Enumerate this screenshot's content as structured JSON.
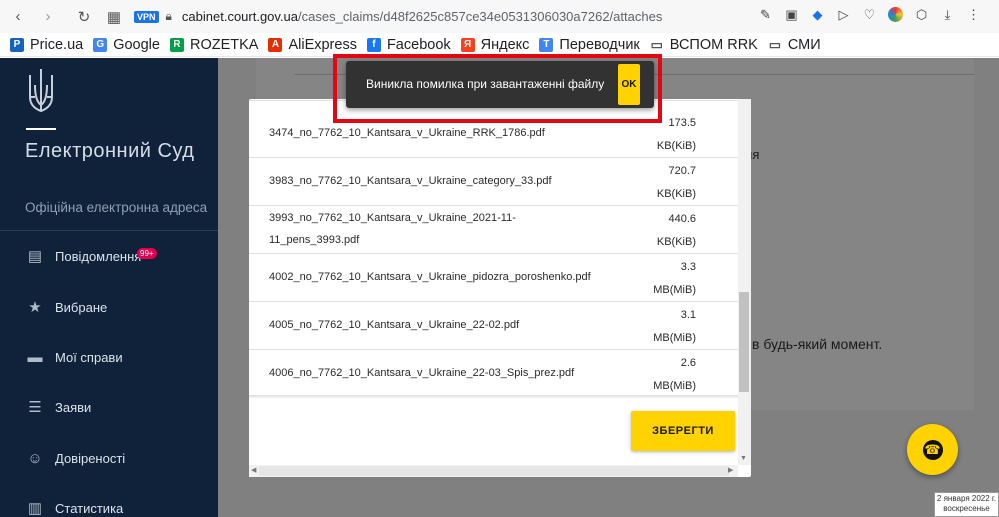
{
  "browser": {
    "vpn_label": "VPN",
    "url_host": "cabinet.court.gov.ua",
    "url_path": "/cases_claims/d48f2625c857ce34e0531306030a7262/attaches"
  },
  "bookmarks": [
    {
      "label": "Price.ua",
      "icon": "price-icon",
      "color": "#1565c0"
    },
    {
      "label": "Google",
      "icon": "google-icon",
      "color": "#4285f4"
    },
    {
      "label": "ROZETKA",
      "icon": "rozetka-icon",
      "color": "#00a046"
    },
    {
      "label": "AliExpress",
      "icon": "aliexpress-icon",
      "color": "#e62e04"
    },
    {
      "label": "Facebook",
      "icon": "facebook-icon",
      "color": "#1877f2"
    },
    {
      "label": "Яндекс",
      "icon": "yandex-icon",
      "color": "#fc3f1d"
    },
    {
      "label": "Переводчик",
      "icon": "translate-icon",
      "color": "#4285f4"
    },
    {
      "label": "ВСПОМ RRK",
      "icon": "folder-icon",
      "color": "#555555"
    },
    {
      "label": "СМИ",
      "icon": "folder-icon",
      "color": "#555555"
    }
  ],
  "sidebar": {
    "title": "Електронний Суд",
    "subtitle": "Офіційна електронна адреса",
    "items": [
      {
        "label": "Повідомлення",
        "icon": "message-icon"
      },
      {
        "label": "Вибране",
        "icon": "star-icon"
      },
      {
        "label": "Мої справи",
        "icon": "folder-icon"
      },
      {
        "label": "Заяви",
        "icon": "list-icon"
      },
      {
        "label": "Довіреності",
        "icon": "people-icon"
      },
      {
        "label": "Статистика",
        "icon": "chart-icon"
      }
    ],
    "notifications_badge": "99+"
  },
  "background": {
    "text_fragment_1": "ння",
    "text_fragment_2": "в будь-який момент."
  },
  "modal": {
    "partial_top_text": "(...)",
    "files": [
      {
        "name": "3474_no_7762_10_Kantsara_v_Ukraine_RRK_1786.pdf",
        "size": "173.5",
        "unit": "KB(KiB)"
      },
      {
        "name": "3983_no_7762_10_Kantsara_v_Ukraine_category_33.pdf",
        "size": "720.7",
        "unit": "KB(KiB)"
      },
      {
        "name": "3993_no_7762_10_Kantsara_v_Ukraine_2021-11-11_pens_3993.pdf",
        "name_line1": "3993_no_7762_10_Kantsara_v_Ukraine_2021-11-",
        "name_line2": "11_pens_3993.pdf",
        "size": "440.6",
        "unit": "KB(KiB)"
      },
      {
        "name": "4002_no_7762_10_Kantsara_v_Ukraine_pidozra_poroshenko.pdf",
        "size": "3.3",
        "unit": "MB(MiB)"
      },
      {
        "name": "4005_no_7762_10_Kantsara_v_Ukraine_22-02.pdf",
        "size": "3.1",
        "unit": "MB(MiB)"
      },
      {
        "name": "4006_no_7762_10_Kantsara_v_Ukraine_22-03_Spis_prez.pdf",
        "size": "2.6",
        "unit": "MB(MiB)"
      }
    ],
    "save_label": "ЗБЕРЕГТИ"
  },
  "toast": {
    "message": "Виникла помилка при завантаженні файлу",
    "ok_label": "OK"
  },
  "datestamp": {
    "line1": "2 января 2022 г.",
    "line2": "воскресенье"
  },
  "colors": {
    "sidebar_bg": "#0f2239",
    "accent_yellow": "#ffd200",
    "highlight_red": "#e30613"
  }
}
